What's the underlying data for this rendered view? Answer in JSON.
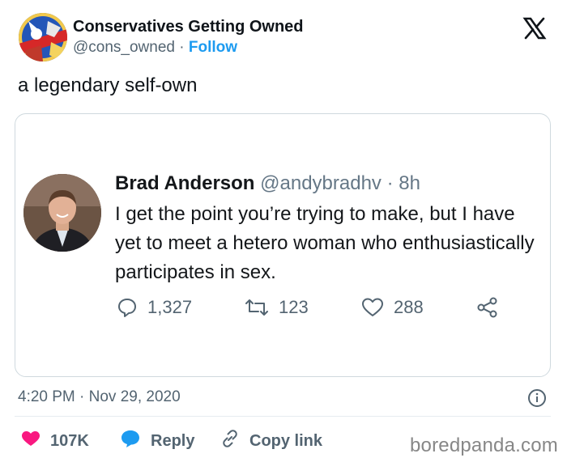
{
  "author": {
    "name": "Conservatives Getting Owned",
    "handle": "@cons_owned",
    "separator": "·",
    "follow_label": "Follow"
  },
  "tweet_text": "a legendary self-own",
  "quoted": {
    "name": "Brad Anderson",
    "handle": "@andybradhv",
    "time": "· 8h",
    "body": "I get the point you’re trying to make, but I have yet to meet a hetero woman who enthusiastically participates in sex.",
    "replies": "1,327",
    "retweets": "123",
    "likes": "288"
  },
  "timestamp": "4:20 PM · Nov 29, 2020",
  "footer": {
    "likes": "107K",
    "reply_label": "Reply",
    "copy_label": "Copy link"
  },
  "watermark": "boredpanda.com",
  "colors": {
    "accent": "#1d9bf0",
    "heart": "#f91880",
    "text_muted": "#536471",
    "border": "#cfd9de"
  },
  "icons": [
    "x-logo-icon",
    "reply-icon",
    "retweet-icon",
    "like-icon",
    "share-icon",
    "info-icon",
    "heart-icon",
    "reply-bubble-icon",
    "link-icon"
  ]
}
